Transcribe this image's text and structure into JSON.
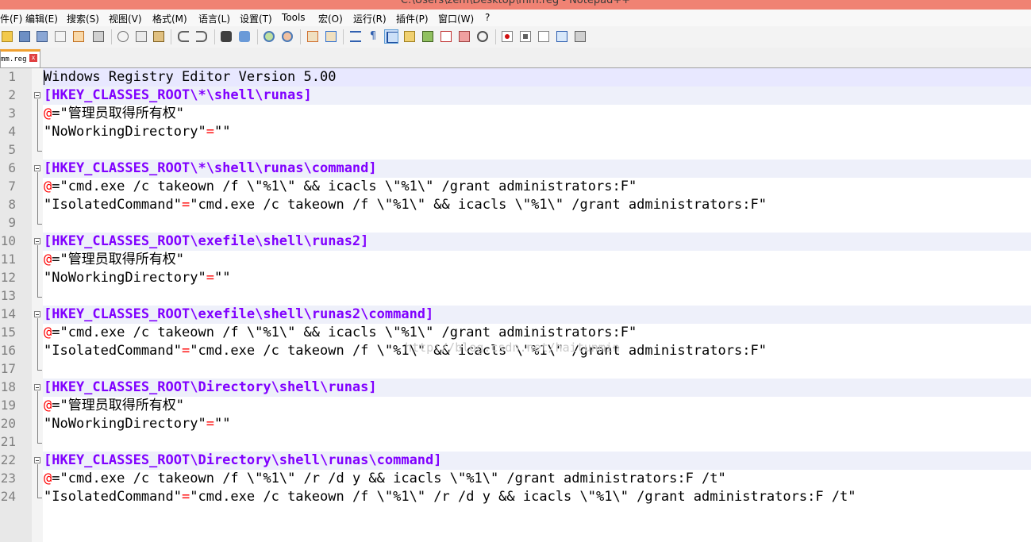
{
  "window": {
    "title": "C:\\Users\\zem\\Desktop\\mm.reg - Notepad++"
  },
  "menu": [
    "件(F)",
    "编辑(E)",
    "搜索(S)",
    "视图(V)",
    "格式(M)",
    "语言(L)",
    "设置(T)",
    "Tools",
    "宏(O)",
    "运行(R)",
    "插件(P)",
    "窗口(W)",
    "?"
  ],
  "tab": {
    "label": "mm.reg",
    "close": "x"
  },
  "watermark": "http://blog.csdn.net/haitunmin",
  "colors": {
    "titlebar": "#f08273",
    "keyword": "#8000ff",
    "operator": "#ff0000",
    "tab_accent": "#f0a030"
  },
  "lines": [
    {
      "num": "1",
      "key": "",
      "op": "",
      "text": "Windows Registry Editor Version 5.00"
    },
    {
      "num": "2",
      "key": "[HKEY_CLASSES_ROOT\\*\\shell\\runas]",
      "op": "",
      "text": ""
    },
    {
      "num": "3",
      "key": "",
      "op": "@=",
      "text": "\"管理员取得所有权\""
    },
    {
      "num": "4",
      "key": "",
      "op": "\"NoWorkingDirectory\"=",
      "text": "\"\""
    },
    {
      "num": "5",
      "key": "",
      "op": "",
      "text": ""
    },
    {
      "num": "6",
      "key": "[HKEY_CLASSES_ROOT\\*\\shell\\runas\\command]",
      "op": "",
      "text": ""
    },
    {
      "num": "7",
      "key": "",
      "op": "@=",
      "text": "\"cmd.exe /c takeown /f \\\"%1\\\" && icacls \\\"%1\\\" /grant administrators:F\""
    },
    {
      "num": "8",
      "key": "",
      "op": "\"IsolatedCommand\"=",
      "text": "\"cmd.exe /c takeown /f \\\"%1\\\" && icacls \\\"%1\\\" /grant administrators:F\""
    },
    {
      "num": "9",
      "key": "",
      "op": "",
      "text": ""
    },
    {
      "num": "10",
      "key": "[HKEY_CLASSES_ROOT\\exefile\\shell\\runas2]",
      "op": "",
      "text": ""
    },
    {
      "num": "11",
      "key": "",
      "op": "@=",
      "text": "\"管理员取得所有权\""
    },
    {
      "num": "12",
      "key": "",
      "op": "\"NoWorkingDirectory\"=",
      "text": "\"\""
    },
    {
      "num": "13",
      "key": "",
      "op": "",
      "text": ""
    },
    {
      "num": "14",
      "key": "[HKEY_CLASSES_ROOT\\exefile\\shell\\runas2\\command]",
      "op": "",
      "text": ""
    },
    {
      "num": "15",
      "key": "",
      "op": "@=",
      "text": "\"cmd.exe /c takeown /f \\\"%1\\\" && icacls \\\"%1\\\" /grant administrators:F\""
    },
    {
      "num": "16",
      "key": "",
      "op": "\"IsolatedCommand\"=",
      "text": "\"cmd.exe /c takeown /f \\\"%1\\\" && icacls \\\"%1\\\" /grant administrators:F\""
    },
    {
      "num": "17",
      "key": "",
      "op": "",
      "text": ""
    },
    {
      "num": "18",
      "key": "[HKEY_CLASSES_ROOT\\Directory\\shell\\runas]",
      "op": "",
      "text": ""
    },
    {
      "num": "19",
      "key": "",
      "op": "@=",
      "text": "\"管理员取得所有权\""
    },
    {
      "num": "20",
      "key": "",
      "op": "\"NoWorkingDirectory\"=",
      "text": "\"\""
    },
    {
      "num": "21",
      "key": "",
      "op": "",
      "text": ""
    },
    {
      "num": "22",
      "key": "[HKEY_CLASSES_ROOT\\Directory\\shell\\runas\\command]",
      "op": "",
      "text": ""
    },
    {
      "num": "23",
      "key": "",
      "op": "@=",
      "text": "\"cmd.exe /c takeown /f \\\"%1\\\" /r /d y && icacls \\\"%1\\\" /grant administrators:F /t\""
    },
    {
      "num": "24",
      "key": "",
      "op": "\"IsolatedCommand\"=",
      "text": "\"cmd.exe /c takeown /f \\\"%1\\\" /r /d y && icacls \\\"%1\\\" /grant administrators:F /t\""
    }
  ]
}
